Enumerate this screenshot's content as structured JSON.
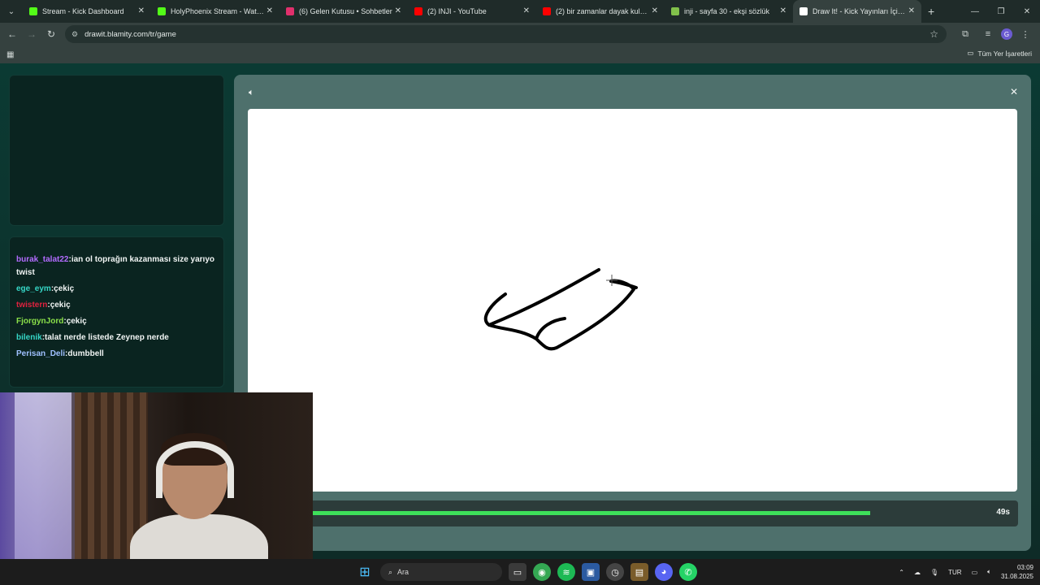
{
  "browser": {
    "tabs": [
      {
        "title": "Stream - Kick Dashboard",
        "color": "#53fc18",
        "active": false
      },
      {
        "title": "HolyPhoenix Stream - Watch Live",
        "color": "#53fc18",
        "active": false
      },
      {
        "title": "(6) Gelen Kutusu • Sohbetler",
        "color": "#e1306c",
        "active": false
      },
      {
        "title": "(2) INJI - YouTube",
        "color": "#ff0000",
        "active": false
      },
      {
        "title": "(2) bir zamanlar dayak kulübü",
        "color": "#ff0000",
        "active": false
      },
      {
        "title": "inji - sayfa 30 - ekşi sözlük",
        "color": "#81c14b",
        "active": false
      },
      {
        "title": "Draw It! - Kick Yayınları İçin Çizim",
        "color": "#ffffff",
        "active": true
      }
    ],
    "url": "drawit.blamity.com/tr/game",
    "bookmarks_all": "Tüm Yer İşaretleri"
  },
  "chat": {
    "messages": [
      {
        "user": "burak_talat22",
        "color": "#b36bff",
        "text": "ian ol toprağın kazanması size yarıyo twist"
      },
      {
        "user": "ege_eym",
        "color": "#36d6c6",
        "text": "çekiç"
      },
      {
        "user": "twistern",
        "color": "#e0223f",
        "text": "çekiç"
      },
      {
        "user": "FjorgynJord",
        "color": "#8be04a",
        "text": "çekiç"
      },
      {
        "user": "bilenik",
        "color": "#36d6c6",
        "text": "talat nerde listede Zeynep nerde"
      },
      {
        "user": "Perisan_Deli",
        "color": "#9fc0ff",
        "text": "dumbbell"
      }
    ]
  },
  "game": {
    "timer_label": "49s",
    "timer_progress": 0.79
  },
  "taskbar": {
    "search_placeholder": "Ara",
    "lang": "TUR",
    "time": "03:09",
    "date": "31.08.2025"
  }
}
